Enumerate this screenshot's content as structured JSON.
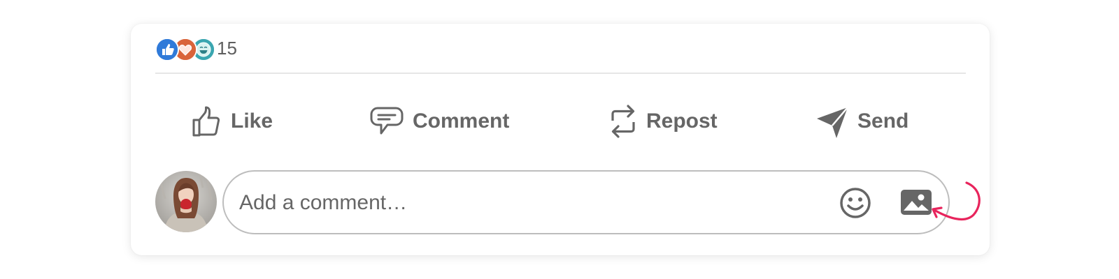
{
  "reactions": {
    "count": "15",
    "icons": [
      "like-reaction",
      "love-reaction",
      "funny-reaction"
    ],
    "colors": {
      "like": "#2f7ad9",
      "love": "#d9643a",
      "funny": "#3aa6b0"
    }
  },
  "actions": {
    "like_label": "Like",
    "comment_label": "Comment",
    "repost_label": "Repost",
    "send_label": "Send"
  },
  "comment": {
    "placeholder": "Add a comment…",
    "value": ""
  },
  "icons": {
    "like": "thumbs-up-icon",
    "comment": "speech-bubble-icon",
    "repost": "repost-arrows-icon",
    "send": "paper-plane-icon",
    "emoji": "smiley-icon",
    "image": "image-icon"
  },
  "colors": {
    "action_text": "#666666",
    "annotation": "#e8245c"
  }
}
